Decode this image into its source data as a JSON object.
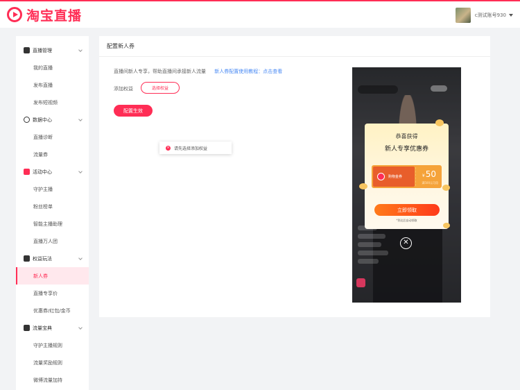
{
  "header": {
    "logo_text": "淘宝直播",
    "username": "c测试账号930"
  },
  "sidebar": {
    "groups": [
      {
        "label": "直播管理",
        "items": [
          "我的直播",
          "发布直播",
          "发布短视频"
        ]
      },
      {
        "label": "数据中心",
        "items": [
          "直播诊断",
          "流量券"
        ]
      },
      {
        "label": "活动中心",
        "items": [
          "守护主播",
          "粉丝榜单",
          "智能主播助理",
          "直播万人团"
        ]
      },
      {
        "label": "权益玩法",
        "items": [
          "新人券",
          "直播专享价",
          "优惠券/红包/金币"
        ]
      },
      {
        "label": "流量宝典",
        "items": [
          "守护主播规则",
          "流量奖励规则",
          "微博流量加持"
        ]
      }
    ],
    "active_item": "新人券"
  },
  "panel": {
    "title": "配置新人券",
    "description": "直播间新人专享，帮助直播间承接新人流量",
    "tutorial_link": "新人券配置使用教程：点击查看",
    "rights_label": "添加权益",
    "select_button": "选择权益",
    "apply_button": "配置生效",
    "toast": "请先选择添加权益"
  },
  "preview": {
    "card_title": "恭喜获得",
    "card_subtitle": "新人专享优惠券",
    "coupon_name": "购物金券",
    "coupon_currency": "¥",
    "coupon_amount": "50",
    "coupon_condition": "满500元可用",
    "claim_button": "立即领取",
    "note": "*到达后自动领取",
    "close_symbol": "✕"
  },
  "colors": {
    "brand": "#ff2d55",
    "link": "#4a8af4",
    "coupon_orange": "#f5a33a"
  }
}
